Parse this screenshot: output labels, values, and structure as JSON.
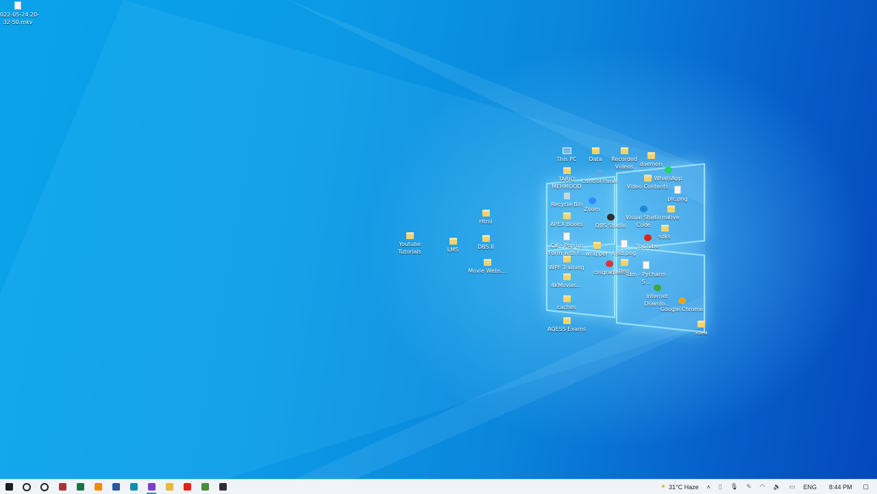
{
  "desktop": {
    "icons": [
      {
        "label": "2022-05-24 20-32-50.mkv",
        "type": "file"
      },
      {
        "label": "This PC",
        "type": "pc"
      },
      {
        "label": "Data",
        "type": "folder"
      },
      {
        "label": "Recorded Videos",
        "type": "folder"
      },
      {
        "label": "daemon",
        "type": "folder"
      },
      {
        "label": "TARIQ MEHMOOD",
        "type": "folder"
      },
      {
        "label": "WhatsApp",
        "type": "app",
        "color": "#25d366"
      },
      {
        "label": "Control Panel",
        "type": "app",
        "color": "#5aa7e8"
      },
      {
        "label": "Video Contents",
        "type": "folder"
      },
      {
        "label": "pic.png",
        "type": "file"
      },
      {
        "label": "Recycle Bin",
        "type": "bin"
      },
      {
        "label": "Zoom",
        "type": "app",
        "color": "#2d8cff"
      },
      {
        "label": "Html",
        "type": "folder"
      },
      {
        "label": "OBS Studio",
        "type": "app",
        "color": "#302e31"
      },
      {
        "label": "Visual Studio Code",
        "type": "app",
        "color": "#1f8ad2"
      },
      {
        "label": "native",
        "type": "folder"
      },
      {
        "label": "APEX Books",
        "type": "folder"
      },
      {
        "label": "Youtube Tutorials",
        "type": "folder"
      },
      {
        "label": "LMS",
        "type": "folder"
      },
      {
        "label": "DBS II",
        "type": "folder"
      },
      {
        "label": "C# - Pop up Form with F...",
        "type": "file"
      },
      {
        "label": "sdks",
        "type": "folder"
      },
      {
        "label": "YouTube",
        "type": "app",
        "color": "#e62117"
      },
      {
        "label": "wrapper",
        "type": "folder"
      },
      {
        "label": "hjsd.png",
        "type": "file"
      },
      {
        "label": "Movie Webs...",
        "type": "folder"
      },
      {
        "label": "WPF Training",
        "type": "folder"
      },
      {
        "label": "cssgradient",
        "type": "app",
        "color": "#d9363e"
      },
      {
        "label": "tmp",
        "type": "folder"
      },
      {
        "label": "idm - Pycharm S...",
        "type": "file"
      },
      {
        "label": "4kMovies...",
        "type": "folder"
      },
      {
        "label": "Internet Downlo...",
        "type": "app",
        "color": "#3aa93a"
      },
      {
        "label": "caches",
        "type": "folder"
      },
      {
        "label": "Google Chrome",
        "type": "app",
        "color": "#e8a317"
      },
      {
        "label": "AQESS Exams",
        "type": "folder"
      },
      {
        "label": ".idea",
        "type": "folder"
      }
    ]
  },
  "taskbar": {
    "apps": [
      {
        "name": "start-button",
        "color": "#1d1d1d"
      },
      {
        "name": "search-icon",
        "color": "#1d1d1d"
      },
      {
        "name": "cortana-icon",
        "color": "#1d1d1d"
      },
      {
        "name": "access-icon",
        "color": "#a4373a"
      },
      {
        "name": "excel-icon",
        "color": "#1e7145"
      },
      {
        "name": "vlc-icon",
        "color": "#f08a00"
      },
      {
        "name": "word-icon",
        "color": "#2b579a"
      },
      {
        "name": "edge-icon",
        "color": "#0f8fb0"
      },
      {
        "name": "visual-studio-icon",
        "color": "#7b3fd0"
      },
      {
        "name": "file-explorer-icon",
        "color": "#e8b93a"
      },
      {
        "name": "youtube-icon",
        "color": "#e62117"
      },
      {
        "name": "chrome-icon",
        "color": "#4a8e3a"
      },
      {
        "name": "obs-icon",
        "color": "#302e31"
      }
    ],
    "tray": {
      "weather": "31°C  Haze",
      "language": "ENG",
      "time": "8:44 PM"
    }
  }
}
